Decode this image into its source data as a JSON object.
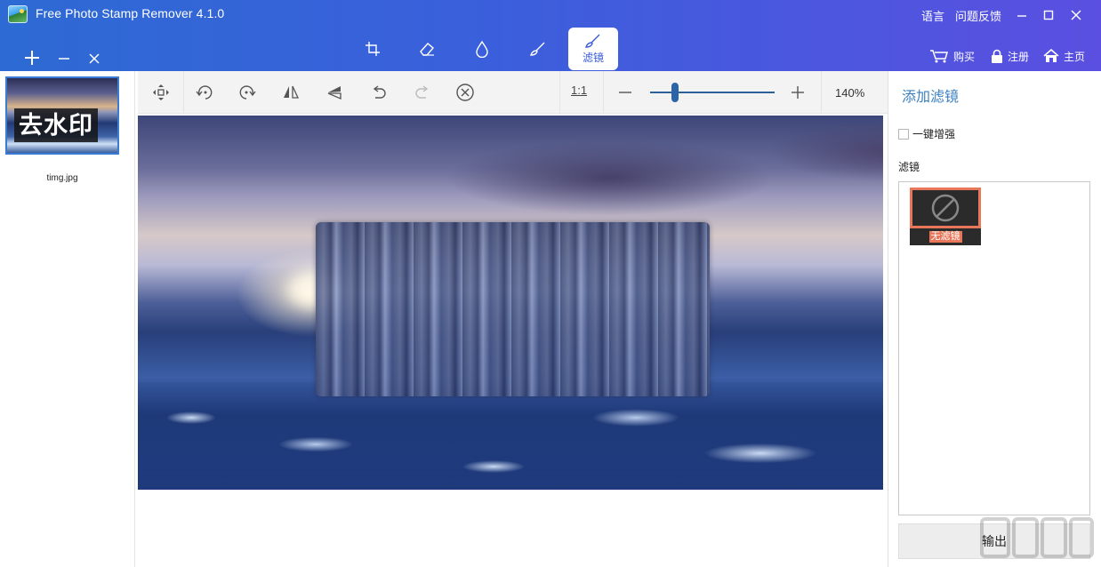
{
  "window": {
    "title": "Free Photo Stamp Remover 4.1.0",
    "links": [
      "语言",
      "问题反馈"
    ]
  },
  "file_buttons": [
    "add-icon",
    "minus-icon",
    "close-icon"
  ],
  "tool_tabs": [
    {
      "icon": "crop-icon",
      "label": ""
    },
    {
      "icon": "eraser-icon",
      "label": ""
    },
    {
      "icon": "drop-icon",
      "label": ""
    },
    {
      "icon": "brush-icon",
      "label": ""
    },
    {
      "icon": "filter-brush-icon",
      "label": "滤镜",
      "active": true
    }
  ],
  "top_actions": {
    "buy": "购买",
    "register": "注册",
    "home": "主页"
  },
  "thumbnail": {
    "overlay_text": "去水印",
    "filename": "timg.jpg"
  },
  "toolbar": {
    "icons": [
      "move-icon",
      "rotate-left-icon",
      "rotate-right-icon",
      "flip-horizontal-icon",
      "flip-vertical-icon",
      "undo-icon",
      "redo-icon",
      "clear-icon"
    ],
    "ratio_label": "1:1",
    "zoom_level_text": "140%",
    "zoom_slider_value": 0.2
  },
  "right_panel": {
    "title": "添加滤镜",
    "enhance_label": "一键增强",
    "enhance_checked": false,
    "filter_section_label": "滤镜",
    "filters": [
      {
        "name": "无滤镜",
        "icon": "none-icon",
        "selected": true
      }
    ],
    "export_label": "输出"
  },
  "colors": {
    "accent": "#3a5bd8",
    "selected": "#e8775a"
  }
}
